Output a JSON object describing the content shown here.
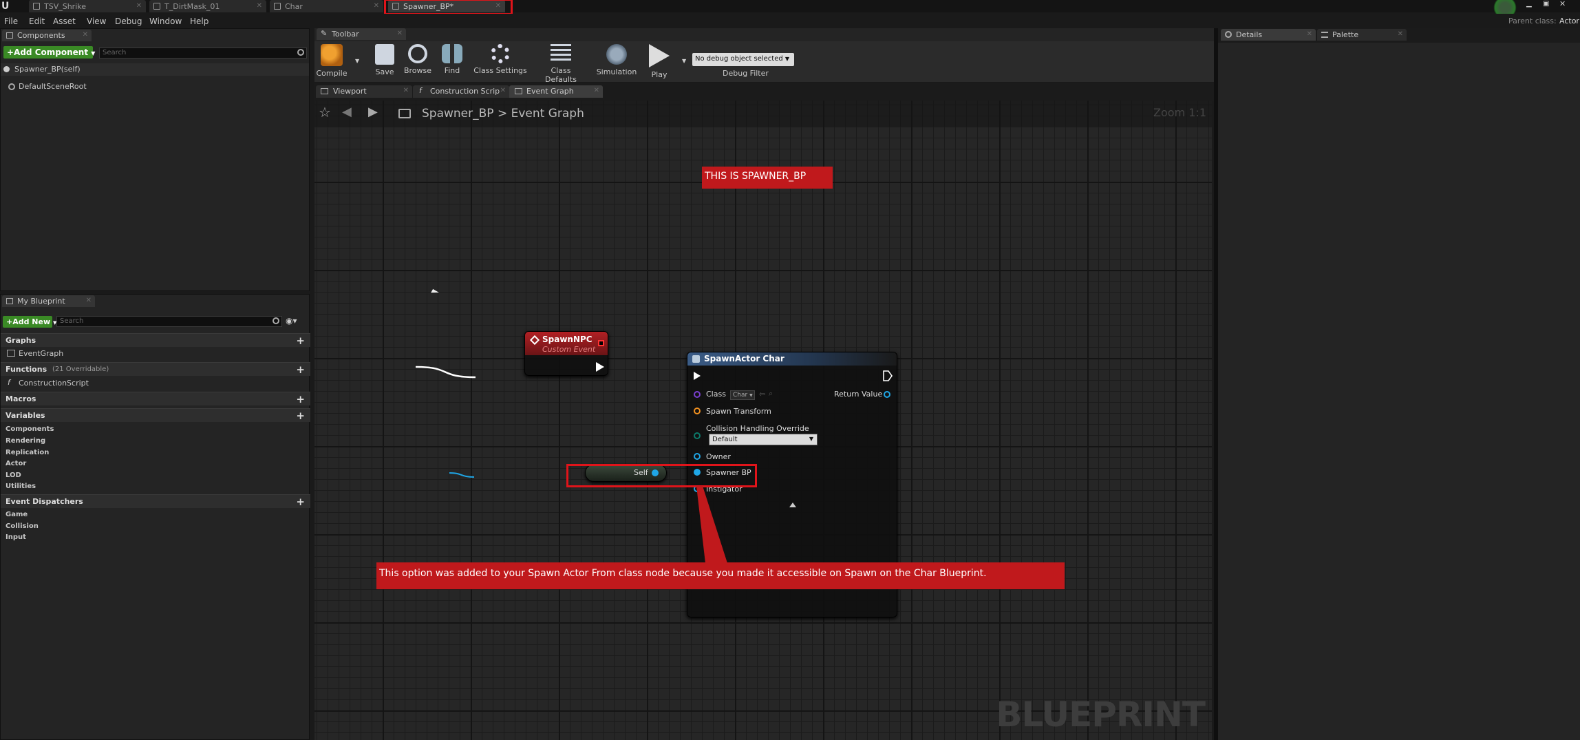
{
  "doc_tabs": [
    {
      "label": "TSV_Shrike"
    },
    {
      "label": "T_DirtMask_01"
    },
    {
      "label": "Char"
    },
    {
      "label": "Spawner_BP*"
    }
  ],
  "header": {
    "parent_class_label": "Parent class:",
    "parent_class_value": "Actor"
  },
  "menu": [
    "File",
    "Edit",
    "Asset",
    "View",
    "Debug",
    "Window",
    "Help"
  ],
  "components_panel": {
    "tab": "Components",
    "add_button": "+Add Component",
    "search_placeholder": "Search",
    "self_item": "Spawner_BP(self)",
    "root_item": "DefaultSceneRoot"
  },
  "my_blueprint": {
    "tab": "My Blueprint",
    "add_button": "+Add New",
    "search_placeholder": "Search",
    "graphs_label": "Graphs",
    "event_graph": "EventGraph",
    "functions_label": "Functions",
    "functions_sub": "(21 Overridable)",
    "construction_script": "ConstructionScript",
    "macros_label": "Macros",
    "variables_label": "Variables",
    "variable_groups": [
      "Components",
      "Rendering",
      "Replication",
      "Actor",
      "LOD",
      "Utilities"
    ],
    "dispatchers_label": "Event Dispatchers",
    "dispatcher_groups": [
      "Game",
      "Collision",
      "Input"
    ]
  },
  "toolbar": {
    "tab": "Toolbar",
    "compile": "Compile",
    "save": "Save",
    "browse": "Browse",
    "find": "Find",
    "class_settings": "Class Settings",
    "class_defaults": "Class Defaults",
    "simulation": "Simulation",
    "play": "Play",
    "debug_select": "No debug object selected",
    "debug_filter": "Debug Filter"
  },
  "graph_tabs": [
    "Viewport",
    "Construction Scrip",
    "Event Graph"
  ],
  "breadcrumb": {
    "root": "Spawner_BP",
    "separator": ">",
    "current": "Event Graph",
    "zoom": "Zoom 1:1"
  },
  "comments": {
    "title_note": "THIS IS SPAWNER_BP",
    "info_note": "This option was added to your Spawn Actor From class node because you made it accessible on Spawn on the Char Blueprint."
  },
  "nodes": {
    "custom_event": {
      "title": "SpawnNPC",
      "subtitle": "Custom Event"
    },
    "spawn_actor": {
      "title": "SpawnActor Char",
      "class_label": "Class",
      "class_value": "Char",
      "return_value": "Return Value",
      "spawn_transform": "Spawn Transform",
      "collision_label": "Collision Handling Override",
      "collision_value": "Default",
      "owner": "Owner",
      "spawner_bp": "Spawner BP",
      "instigator": "Instigator"
    },
    "self_node": {
      "label": "Self"
    }
  },
  "watermark": "BLUEPRINT",
  "right_panel": {
    "details_tab": "Details",
    "palette_tab": "Palette"
  },
  "colors": {
    "accent_red": "#e0141a",
    "comment_red": "#c0191c",
    "green": "#3a8a25",
    "pin_blue": "#1fa6e6"
  }
}
